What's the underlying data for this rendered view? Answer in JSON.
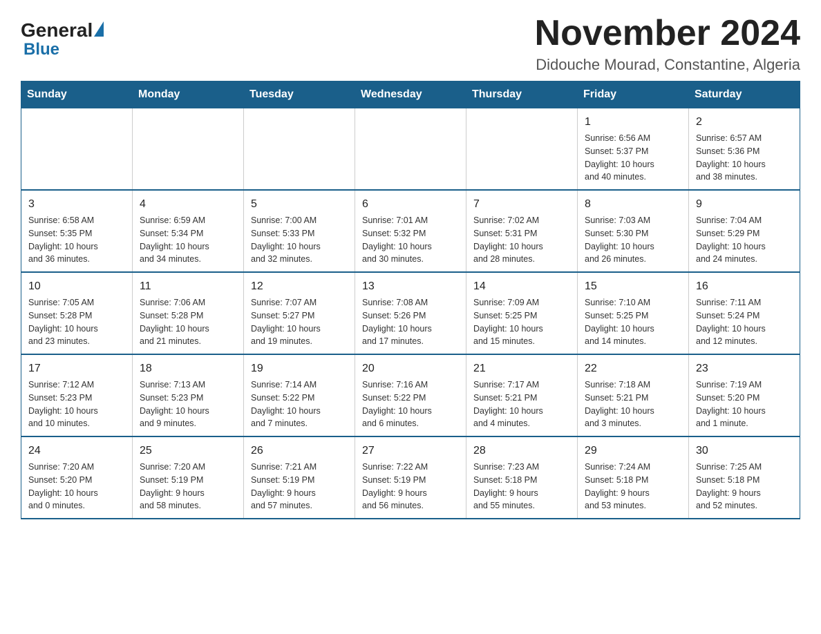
{
  "header": {
    "logo_general": "General",
    "logo_blue": "Blue",
    "month_title": "November 2024",
    "subtitle": "Didouche Mourad, Constantine, Algeria"
  },
  "weekdays": [
    "Sunday",
    "Monday",
    "Tuesday",
    "Wednesday",
    "Thursday",
    "Friday",
    "Saturday"
  ],
  "weeks": [
    [
      {
        "day": "",
        "info": ""
      },
      {
        "day": "",
        "info": ""
      },
      {
        "day": "",
        "info": ""
      },
      {
        "day": "",
        "info": ""
      },
      {
        "day": "",
        "info": ""
      },
      {
        "day": "1",
        "info": "Sunrise: 6:56 AM\nSunset: 5:37 PM\nDaylight: 10 hours\nand 40 minutes."
      },
      {
        "day": "2",
        "info": "Sunrise: 6:57 AM\nSunset: 5:36 PM\nDaylight: 10 hours\nand 38 minutes."
      }
    ],
    [
      {
        "day": "3",
        "info": "Sunrise: 6:58 AM\nSunset: 5:35 PM\nDaylight: 10 hours\nand 36 minutes."
      },
      {
        "day": "4",
        "info": "Sunrise: 6:59 AM\nSunset: 5:34 PM\nDaylight: 10 hours\nand 34 minutes."
      },
      {
        "day": "5",
        "info": "Sunrise: 7:00 AM\nSunset: 5:33 PM\nDaylight: 10 hours\nand 32 minutes."
      },
      {
        "day": "6",
        "info": "Sunrise: 7:01 AM\nSunset: 5:32 PM\nDaylight: 10 hours\nand 30 minutes."
      },
      {
        "day": "7",
        "info": "Sunrise: 7:02 AM\nSunset: 5:31 PM\nDaylight: 10 hours\nand 28 minutes."
      },
      {
        "day": "8",
        "info": "Sunrise: 7:03 AM\nSunset: 5:30 PM\nDaylight: 10 hours\nand 26 minutes."
      },
      {
        "day": "9",
        "info": "Sunrise: 7:04 AM\nSunset: 5:29 PM\nDaylight: 10 hours\nand 24 minutes."
      }
    ],
    [
      {
        "day": "10",
        "info": "Sunrise: 7:05 AM\nSunset: 5:28 PM\nDaylight: 10 hours\nand 23 minutes."
      },
      {
        "day": "11",
        "info": "Sunrise: 7:06 AM\nSunset: 5:28 PM\nDaylight: 10 hours\nand 21 minutes."
      },
      {
        "day": "12",
        "info": "Sunrise: 7:07 AM\nSunset: 5:27 PM\nDaylight: 10 hours\nand 19 minutes."
      },
      {
        "day": "13",
        "info": "Sunrise: 7:08 AM\nSunset: 5:26 PM\nDaylight: 10 hours\nand 17 minutes."
      },
      {
        "day": "14",
        "info": "Sunrise: 7:09 AM\nSunset: 5:25 PM\nDaylight: 10 hours\nand 15 minutes."
      },
      {
        "day": "15",
        "info": "Sunrise: 7:10 AM\nSunset: 5:25 PM\nDaylight: 10 hours\nand 14 minutes."
      },
      {
        "day": "16",
        "info": "Sunrise: 7:11 AM\nSunset: 5:24 PM\nDaylight: 10 hours\nand 12 minutes."
      }
    ],
    [
      {
        "day": "17",
        "info": "Sunrise: 7:12 AM\nSunset: 5:23 PM\nDaylight: 10 hours\nand 10 minutes."
      },
      {
        "day": "18",
        "info": "Sunrise: 7:13 AM\nSunset: 5:23 PM\nDaylight: 10 hours\nand 9 minutes."
      },
      {
        "day": "19",
        "info": "Sunrise: 7:14 AM\nSunset: 5:22 PM\nDaylight: 10 hours\nand 7 minutes."
      },
      {
        "day": "20",
        "info": "Sunrise: 7:16 AM\nSunset: 5:22 PM\nDaylight: 10 hours\nand 6 minutes."
      },
      {
        "day": "21",
        "info": "Sunrise: 7:17 AM\nSunset: 5:21 PM\nDaylight: 10 hours\nand 4 minutes."
      },
      {
        "day": "22",
        "info": "Sunrise: 7:18 AM\nSunset: 5:21 PM\nDaylight: 10 hours\nand 3 minutes."
      },
      {
        "day": "23",
        "info": "Sunrise: 7:19 AM\nSunset: 5:20 PM\nDaylight: 10 hours\nand 1 minute."
      }
    ],
    [
      {
        "day": "24",
        "info": "Sunrise: 7:20 AM\nSunset: 5:20 PM\nDaylight: 10 hours\nand 0 minutes."
      },
      {
        "day": "25",
        "info": "Sunrise: 7:20 AM\nSunset: 5:19 PM\nDaylight: 9 hours\nand 58 minutes."
      },
      {
        "day": "26",
        "info": "Sunrise: 7:21 AM\nSunset: 5:19 PM\nDaylight: 9 hours\nand 57 minutes."
      },
      {
        "day": "27",
        "info": "Sunrise: 7:22 AM\nSunset: 5:19 PM\nDaylight: 9 hours\nand 56 minutes."
      },
      {
        "day": "28",
        "info": "Sunrise: 7:23 AM\nSunset: 5:18 PM\nDaylight: 9 hours\nand 55 minutes."
      },
      {
        "day": "29",
        "info": "Sunrise: 7:24 AM\nSunset: 5:18 PM\nDaylight: 9 hours\nand 53 minutes."
      },
      {
        "day": "30",
        "info": "Sunrise: 7:25 AM\nSunset: 5:18 PM\nDaylight: 9 hours\nand 52 minutes."
      }
    ]
  ]
}
